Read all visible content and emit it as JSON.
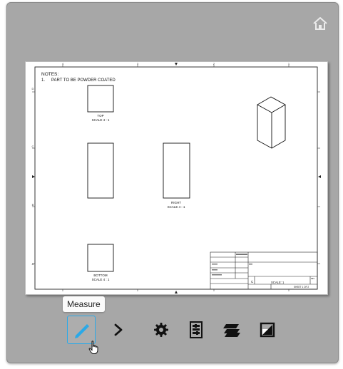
{
  "toolbar": {
    "tooltip": "Measure",
    "tools": [
      {
        "id": "measure",
        "icon": "pencil-ruler-icon",
        "active": true
      },
      {
        "id": "explode",
        "icon": "chevron-right-icon",
        "active": false
      },
      {
        "id": "settings",
        "icon": "gear-icon",
        "active": false
      },
      {
        "id": "properties",
        "icon": "sliders-icon",
        "active": false
      },
      {
        "id": "layers",
        "icon": "layers-icon",
        "active": false
      },
      {
        "id": "fullscreen",
        "icon": "expand-icon",
        "active": false
      }
    ]
  },
  "drawing": {
    "notes_title": "NOTES:",
    "note_1_number": "1.",
    "note_1_text": "PART TO BE POWDER COATED",
    "views": {
      "top_label": "TOP",
      "top_scale": "SCALE 4 : 1",
      "right_label": "RIGHT",
      "right_scale": "SCALE 4 : 1",
      "bottom_label": "BOTTOM",
      "bottom_scale": "SCALE 4 : 1"
    },
    "border_cols_top": [
      "4",
      "3",
      "2",
      "1"
    ],
    "border_rows_left": [
      "D",
      "C",
      "B",
      "A"
    ],
    "title_block": {
      "size": "C",
      "scale": "SCALE: 1",
      "sheet": "SHEET 1 OF 2",
      "rev": "REV"
    }
  },
  "colors": {
    "viewer_bg": "#a7a7a7",
    "active_outline": "#2aa9e8",
    "icon": "#111111"
  }
}
